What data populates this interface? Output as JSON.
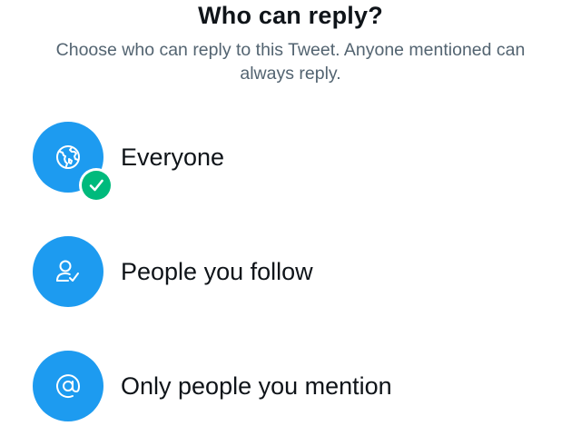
{
  "dialog": {
    "title": "Who can reply?",
    "subtitle": "Choose who can reply to this Tweet. Anyone mentioned can always reply."
  },
  "options": [
    {
      "label": "Everyone",
      "icon": "globe-icon",
      "selected": true
    },
    {
      "label": "People you follow",
      "icon": "person-check-icon",
      "selected": false
    },
    {
      "label": "Only people you mention",
      "icon": "at-sign-icon",
      "selected": false
    }
  ],
  "colors": {
    "accent": "#1d9bf0",
    "selected_check": "#00ba7c",
    "title_text": "#0f1419",
    "subtitle_text": "#536471"
  }
}
